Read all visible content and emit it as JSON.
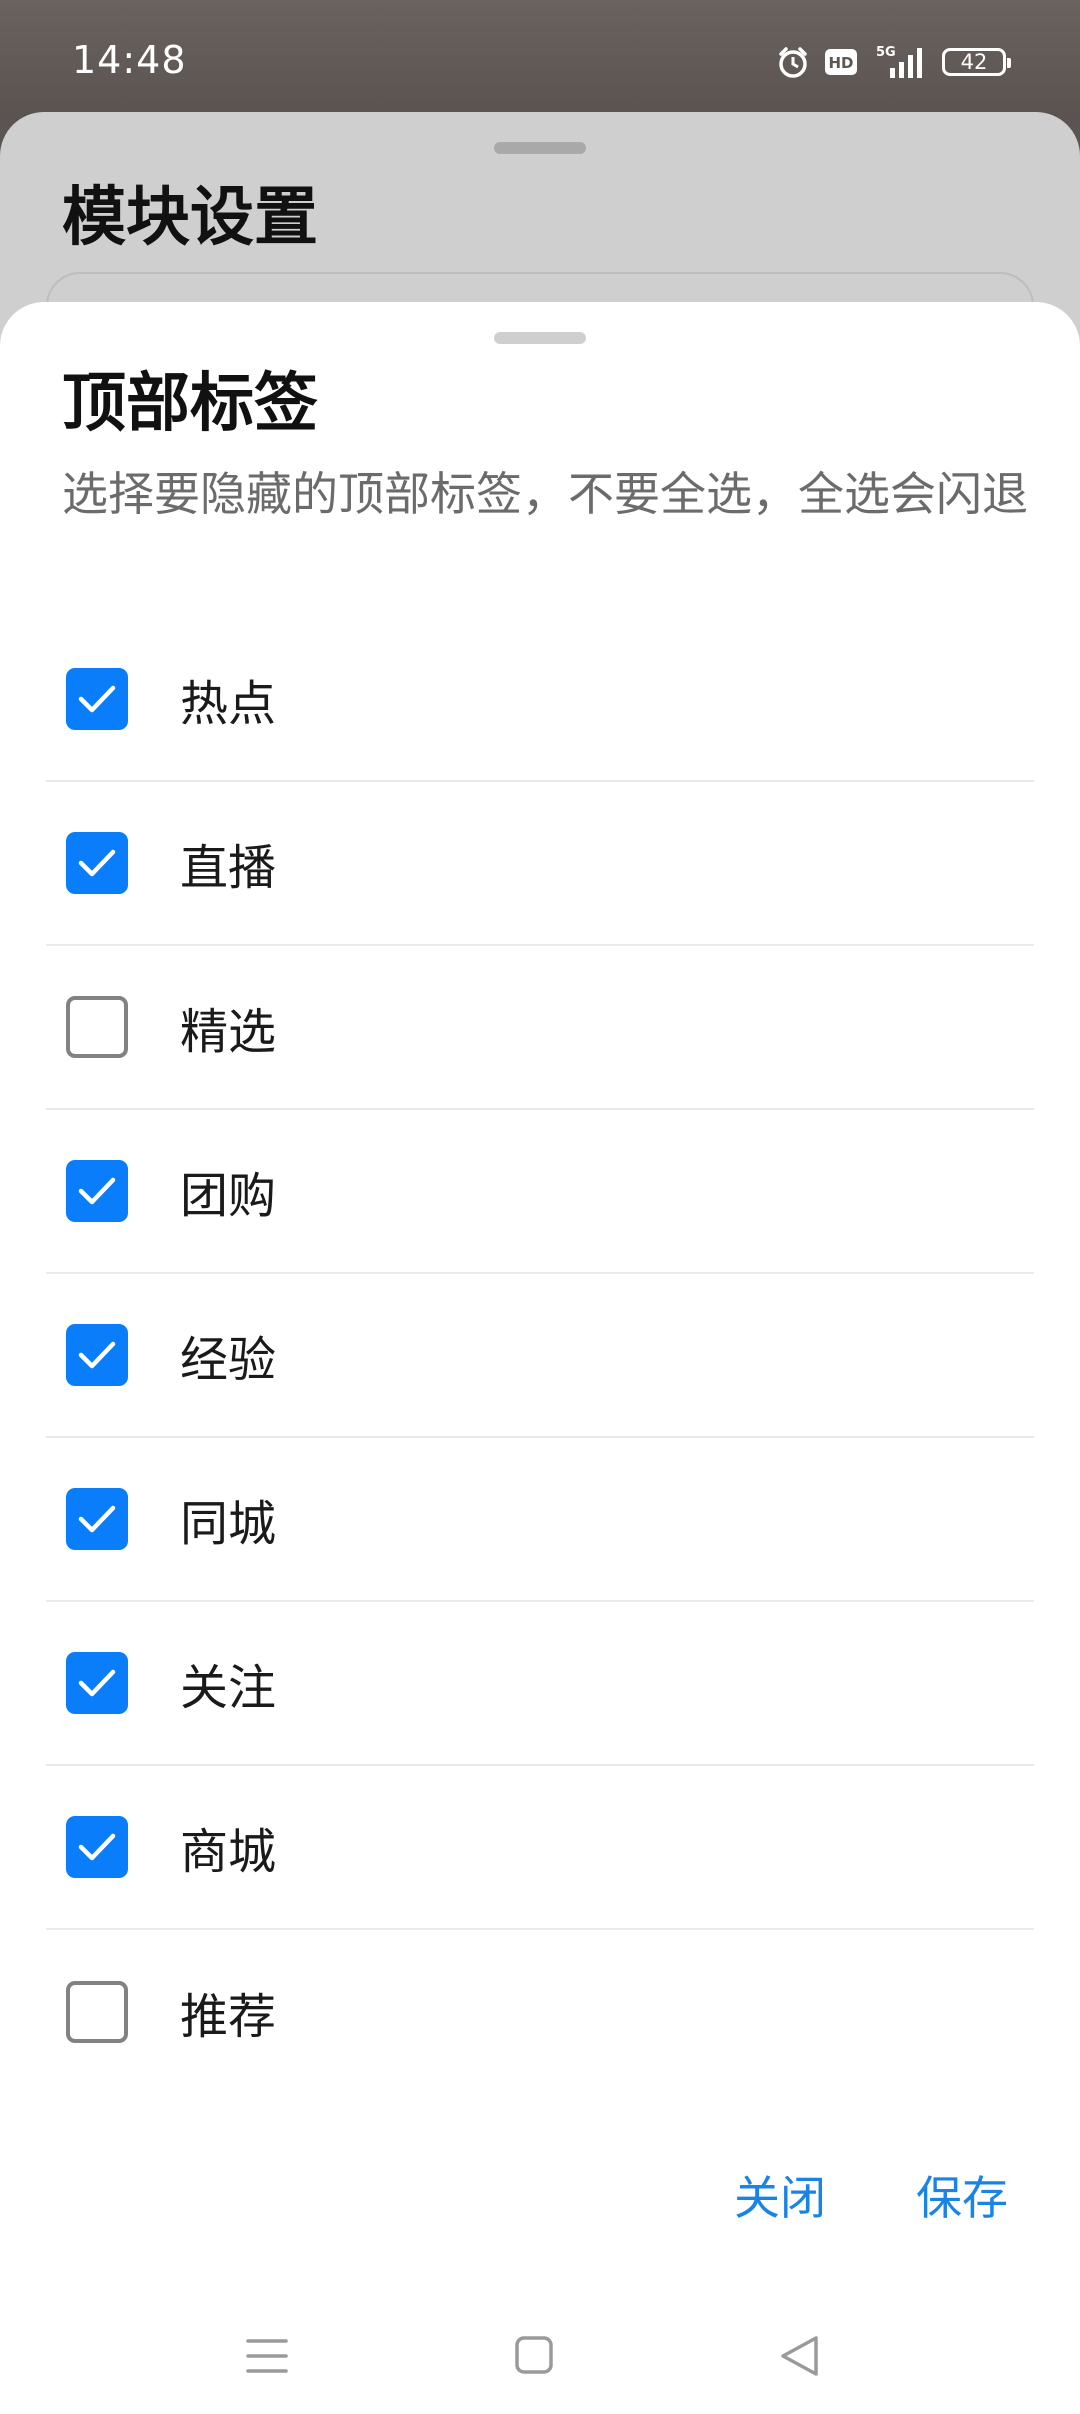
{
  "status_bar": {
    "time": "14:48",
    "battery": "42",
    "icons": [
      "alarm-icon",
      "hd-icon",
      "5g-signal-icon",
      "battery-icon"
    ],
    "hd_label": "HD",
    "network_label": "5G"
  },
  "background_page": {
    "title": "模块设置"
  },
  "dialog": {
    "title": "顶部标签",
    "description": "选择要隐藏的顶部标签，不要全选，全选会闪退",
    "options": [
      {
        "label": "热点",
        "checked": true
      },
      {
        "label": "直播",
        "checked": true
      },
      {
        "label": "精选",
        "checked": false
      },
      {
        "label": "团购",
        "checked": true
      },
      {
        "label": "经验",
        "checked": true
      },
      {
        "label": "同城",
        "checked": true
      },
      {
        "label": "关注",
        "checked": true
      },
      {
        "label": "商城",
        "checked": true
      },
      {
        "label": "推荐",
        "checked": false
      }
    ],
    "close_label": "关闭",
    "save_label": "保存"
  },
  "nav_bar": {
    "icons": [
      "menu-icon",
      "home-icon",
      "back-icon"
    ]
  },
  "colors": {
    "accent": "#0a7dfa",
    "action_text": "#1a84e6",
    "unchecked_border": "#828282"
  }
}
